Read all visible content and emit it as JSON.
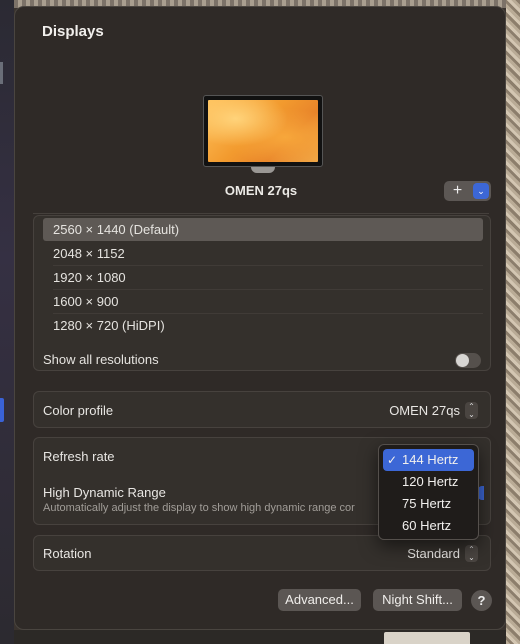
{
  "window": {
    "title": "Displays"
  },
  "display": {
    "name": "OMEN 27qs"
  },
  "add_button": {
    "plus": "+",
    "chevron": "⌄"
  },
  "resolutions": [
    {
      "label": "2560 × 1440 (Default)",
      "selected": true
    },
    {
      "label": "2048 × 1152",
      "selected": false
    },
    {
      "label": "1920 × 1080",
      "selected": false
    },
    {
      "label": "1600 × 900",
      "selected": false
    },
    {
      "label": "1280 × 720 (HiDPI)",
      "selected": false
    }
  ],
  "show_all": {
    "label": "Show all resolutions",
    "enabled": false
  },
  "color_profile": {
    "label": "Color profile",
    "value": "OMEN 27qs"
  },
  "refresh_rate": {
    "label": "Refresh rate",
    "options": [
      "144 Hertz",
      "120 Hertz",
      "75 Hertz",
      "60 Hertz"
    ],
    "selected": "144 Hertz"
  },
  "hdr": {
    "label": "High Dynamic Range",
    "description": "Automatically adjust the display to show high dynamic range cor"
  },
  "rotation": {
    "label": "Rotation",
    "value": "Standard"
  },
  "footer": {
    "advanced": "Advanced...",
    "night_shift": "Night Shift...",
    "help": "?"
  },
  "icons": {
    "check": "✓",
    "stepper_up": "⌃",
    "stepper_down": "⌄"
  },
  "colors": {
    "accent": "#3c67d6",
    "window_bg": "#2f2a27",
    "panel_bg": "#34302c"
  }
}
